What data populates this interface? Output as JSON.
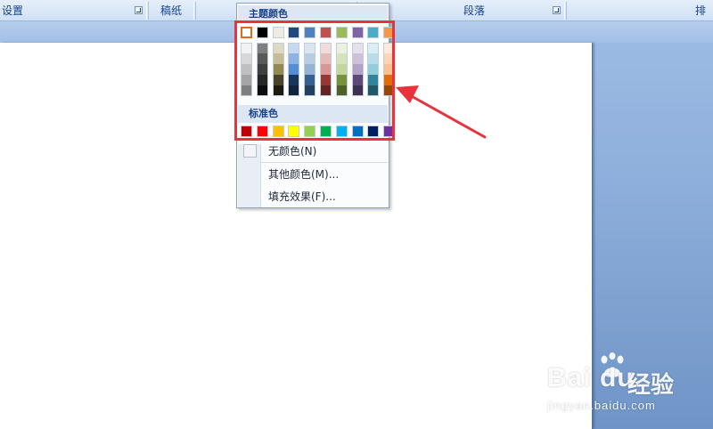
{
  "ribbon": {
    "groups": [
      {
        "label": "设置",
        "launcher": true
      },
      {
        "label": "稿纸",
        "launcher": false
      },
      {
        "label": "",
        "launcher": false
      },
      {
        "label": "段落",
        "launcher": true
      },
      {
        "label": "排",
        "launcher": false
      }
    ]
  },
  "color_menu": {
    "theme_header": "主题颜色",
    "standard_header": "标准色",
    "theme_colors": [
      "#ffffff",
      "#000000",
      "#eeece1",
      "#1f497d",
      "#4f81bd",
      "#c0504d",
      "#9bbb59",
      "#8064a2",
      "#4bacc6",
      "#f79646"
    ],
    "theme_tints": [
      [
        "#f2f2f2",
        "#d8d8d8",
        "#bfbfbf",
        "#a5a5a5",
        "#7f7f7f"
      ],
      [
        "#7f7f7f",
        "#595959",
        "#3f3f3f",
        "#262626",
        "#0c0c0c"
      ],
      [
        "#ddd9c3",
        "#c4bd97",
        "#938953",
        "#494429",
        "#1d1b10"
      ],
      [
        "#c6d9f0",
        "#8db3e2",
        "#548dd4",
        "#17365d",
        "#0f243e"
      ],
      [
        "#dbe5f1",
        "#b8cce4",
        "#95b3d7",
        "#366092",
        "#244061"
      ],
      [
        "#f2dcdb",
        "#e5b9b7",
        "#d99694",
        "#953734",
        "#632423"
      ],
      [
        "#ebf1dd",
        "#d7e3bc",
        "#c3d69b",
        "#76923c",
        "#4f6128"
      ],
      [
        "#e5e0ec",
        "#ccc1d9",
        "#b2a2c7",
        "#5f497a",
        "#3f3151"
      ],
      [
        "#dbeef3",
        "#b7dde8",
        "#92cddc",
        "#31859b",
        "#205867"
      ],
      [
        "#fdeada",
        "#fbd5b5",
        "#fac08f",
        "#e36c09",
        "#974806"
      ]
    ],
    "standard_colors": [
      "#c00000",
      "#ff0000",
      "#ffc000",
      "#ffff00",
      "#92d050",
      "#00b050",
      "#00b0f0",
      "#0070c0",
      "#002060",
      "#7030a0"
    ],
    "items": [
      {
        "label": "无颜色(N)",
        "name": "no-color"
      },
      {
        "label": "其他颜色(M)...",
        "name": "more-colors"
      },
      {
        "label": "填充效果(F)...",
        "name": "fill-effects"
      }
    ]
  },
  "annotation": {
    "color": "#e8333c"
  },
  "watermark": {
    "brand": "Bai du",
    "product": "经验",
    "url": "jingyan.baidu.com"
  }
}
